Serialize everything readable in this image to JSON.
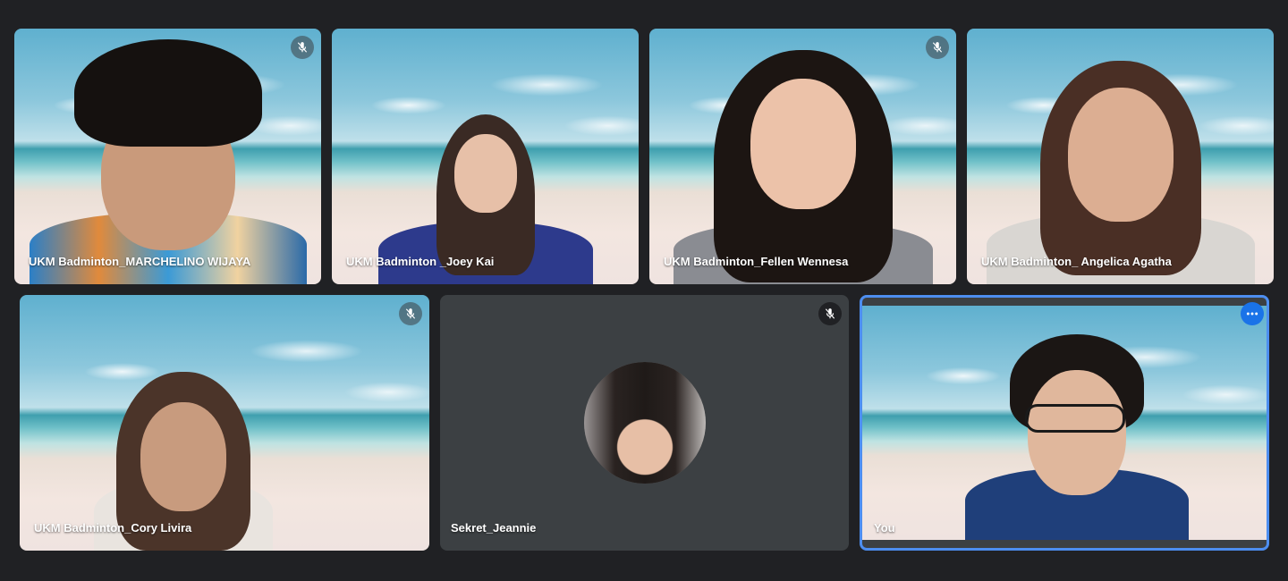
{
  "participants": [
    {
      "name": "UKM Badminton_MARCHELINO WIJAYA",
      "muted": true
    },
    {
      "name": "UKM Badminton _Joey Kai",
      "muted": false
    },
    {
      "name": "UKM Badminton_Fellen Wennesa",
      "muted": true
    },
    {
      "name": "UKM Badminton_ Angelica Agatha",
      "muted": false
    },
    {
      "name": "UKM Badminton_Cory Livira",
      "muted": true
    },
    {
      "name": "Sekret_Jeannie",
      "muted": true,
      "camera_off": true
    },
    {
      "name": "You",
      "muted": false,
      "self": true
    }
  ],
  "icons": {
    "mute": "mic-off-icon",
    "more": "more-options-icon"
  },
  "colors": {
    "background": "#202124",
    "self_highlight": "#4d8ef0",
    "more_button": "#1a73e8"
  }
}
